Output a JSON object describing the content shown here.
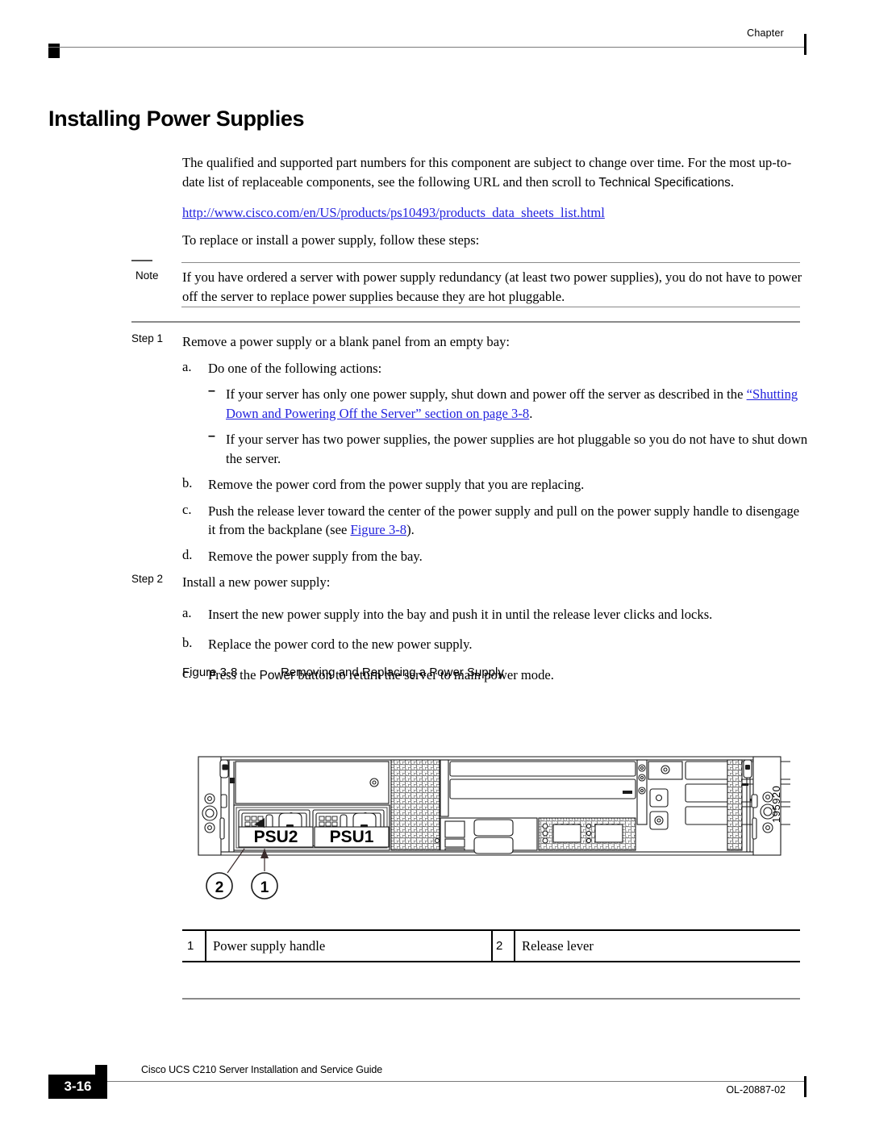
{
  "header": {
    "chapter_label": "Chapter"
  },
  "title": "Installing Power Supplies",
  "intro": {
    "paragraph_part1": "The qualified and supported part numbers for this component are subject to change over time. For the most up-to-date list of replaceable components, see the following URL and then scroll to ",
    "paragraph_emphasis": "Technical Specifications",
    "paragraph_part2": ".",
    "url": "http://www.cisco.com/en/US/products/ps10493/products_data_sheets_list.html",
    "lead_in": "To replace or install a power supply, follow these steps:"
  },
  "note": {
    "label": "Note",
    "text": "If you have ordered a server with power supply redundancy (at least two power supplies), you do not have to power off the server to replace power supplies because they are hot pluggable."
  },
  "steps": [
    {
      "label": "Step 1",
      "text": "Remove a power supply or a blank panel from an empty bay:",
      "substeps": [
        {
          "marker": "a.",
          "text": "Do one of the following actions:",
          "dashes": [
            {
              "marker": "–",
              "text_before": "If your server has only one power supply, shut down and power off the server as described in the ",
              "link": "“Shutting Down and Powering Off the Server” section on page 3-8",
              "text_after": "."
            },
            {
              "marker": "–",
              "text_before": "If your server has two power supplies, the power supplies are hot pluggable so you do not have to shut down the server.",
              "link": "",
              "text_after": ""
            }
          ]
        },
        {
          "marker": "b.",
          "text": "Remove the power cord from the power supply that you are replacing.",
          "dashes": []
        },
        {
          "marker": "c.",
          "text_before": "Push the release lever toward the center of the power supply and pull on the power supply handle to disengage it from the backplane (see ",
          "link": "Figure 3-8",
          "text_after": ").",
          "dashes": []
        },
        {
          "marker": "d.",
          "text": "Remove the power supply from the bay.",
          "dashes": []
        }
      ]
    },
    {
      "label": "Step 2",
      "text": "Install a new power supply:",
      "substeps": [
        {
          "marker": "a.",
          "text": "Insert the new power supply into the bay and push it in until the release lever clicks and locks.",
          "dashes": []
        },
        {
          "marker": "b.",
          "text": "Replace the power cord to the new power supply.",
          "dashes": []
        },
        {
          "marker": "c.",
          "text_before": "Press the ",
          "emphasis": "Power",
          "text_after": " button to return the server to main power mode.",
          "dashes": []
        }
      ]
    }
  ],
  "figure": {
    "number": "Figure 3-8",
    "caption": "Removing and Replacing a Power Supply",
    "art_id": "195920",
    "psu_labels": [
      "PSU2",
      "PSU1"
    ],
    "callouts": [
      "2",
      "1"
    ]
  },
  "legend": {
    "entries": [
      {
        "num": "1",
        "text": "Power supply handle"
      },
      {
        "num": "2",
        "text": "Release lever"
      }
    ]
  },
  "footer": {
    "page_number": "3-16",
    "guide_title": "Cisco UCS C210 Server Installation and Service Guide",
    "doc_number": "OL-20887-02"
  },
  "colors": {
    "link": "#2222dd",
    "rule": "#8a8a8a",
    "ink": "#000000"
  }
}
